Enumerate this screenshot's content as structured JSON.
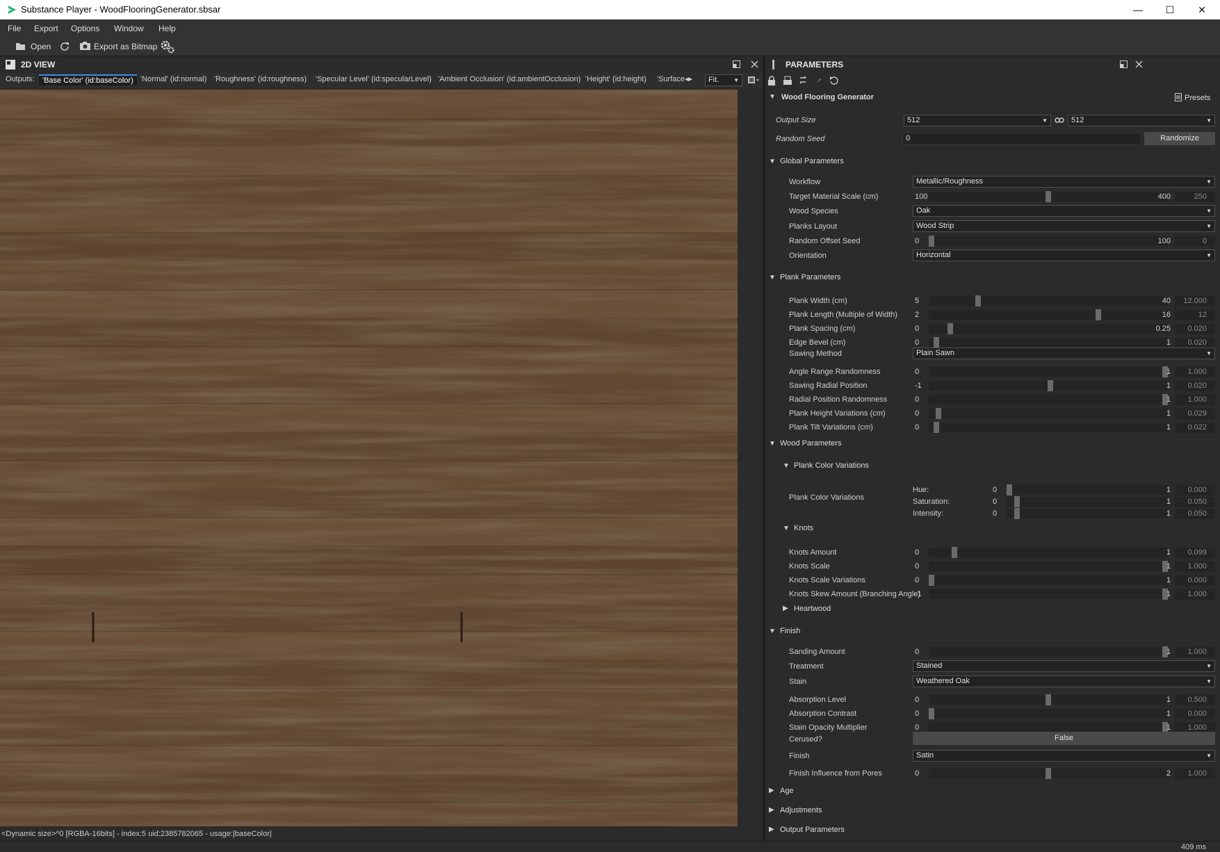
{
  "window": {
    "title": "Substance Player - WoodFlooringGenerator.sbsar",
    "minimize": "—",
    "maximize": "☐",
    "close": "✕"
  },
  "menu": [
    "File",
    "Export",
    "Options",
    "Window",
    "Help"
  ],
  "toolbar": {
    "open": "Open",
    "export_bitmap": "Export as Bitmap"
  },
  "view2d": {
    "title": "2D VIEW",
    "outputs_label": "Outputs:",
    "tabs": [
      "'Base Color' (id:baseColor)",
      "'Normal' (id:normal)",
      "'Roughness' (id:roughness)",
      "'Specular Level' (id:specularLevel)",
      "'Ambient Occlusion' (id:ambientOcclusion)",
      "'Height' (id:height)",
      "'Surface"
    ],
    "zoom": "Fit.",
    "status": "<Dynamic size>^0 [RGBA-16bits] - index:5 uid:2385782065 - usage:|baseColor|"
  },
  "params": {
    "title": "PARAMETERS",
    "graph": "Wood Flooring Generator",
    "presets": "Presets",
    "output_size": {
      "label": "Output Size",
      "w": "512",
      "h": "512"
    },
    "random_seed": {
      "label": "Random Seed",
      "value": "0",
      "button": "Randomize"
    },
    "global": {
      "title": "Global Parameters",
      "workflow": {
        "label": "Workflow",
        "value": "Metallic/Roughness"
      },
      "scale": {
        "label": "Target Material Scale (cm)",
        "min": "100",
        "max": "400",
        "value": "250",
        "fraction": 0.5
      },
      "species": {
        "label": "Wood Species",
        "value": "Oak"
      },
      "layout": {
        "label": "Planks Layout",
        "value": "Wood Strip"
      },
      "offset": {
        "label": "Random Offset Seed",
        "min": "0",
        "max": "100",
        "value": "0",
        "fraction": 0.0
      },
      "orientation": {
        "label": "Orientation",
        "value": "Horizontal"
      }
    },
    "plank": {
      "title": "Plank Parameters",
      "rows": [
        {
          "label": "Plank Width (cm)",
          "min": "5",
          "max": "40",
          "value": "12.000",
          "fraction": 0.2
        },
        {
          "label": "Plank Length (Multiple of Width)",
          "min": "2",
          "max": "16",
          "value": "12",
          "fraction": 0.714
        },
        {
          "label": "Plank Spacing (cm)",
          "min": "0",
          "max": "0.25",
          "value": "0.020",
          "fraction": 0.08
        },
        {
          "label": "Edge Bevel (cm)",
          "min": "0",
          "max": "1",
          "value": "0.020",
          "fraction": 0.02
        }
      ],
      "sawing": {
        "label": "Sawing Method",
        "value": "Plain Sawn"
      },
      "rows2": [
        {
          "label": "Angle Range Randomness",
          "min": "0",
          "max": "1",
          "value": "1.000",
          "fraction": 1.0
        },
        {
          "label": "Sawing Radial Position",
          "min": "-1",
          "max": "1",
          "value": "0.020",
          "fraction": 0.51
        },
        {
          "label": "Radial Position Randomness",
          "min": "0",
          "max": "1",
          "value": "1.000",
          "fraction": 1.0
        },
        {
          "label": "Plank Height Variations (cm)",
          "min": "0",
          "max": "1",
          "value": "0.029",
          "fraction": 0.029
        },
        {
          "label": "Plank Tilt Variations (cm)",
          "min": "0",
          "max": "1",
          "value": "0.022",
          "fraction": 0.022
        }
      ]
    },
    "wood": {
      "title": "Wood Parameters",
      "pcv_title": "Plank Color Variations",
      "pcv_label": "Plank Color Variations",
      "hsi": [
        {
          "label": "Hue:",
          "min": "0",
          "max": "1",
          "value": "0.000",
          "fraction": 0.0
        },
        {
          "label": "Saturation:",
          "min": "0",
          "max": "1",
          "value": "0.050",
          "fraction": 0.05
        },
        {
          "label": "Intensity:",
          "min": "0",
          "max": "1",
          "value": "0.050",
          "fraction": 0.05
        }
      ],
      "knots_title": "Knots",
      "knots": [
        {
          "label": "Knots Amount",
          "min": "0",
          "max": "1",
          "value": "0.099",
          "fraction": 0.099
        },
        {
          "label": "Knots Scale",
          "min": "0",
          "max": "1",
          "value": "1.000",
          "fraction": 1.0
        },
        {
          "label": "Knots Scale Variations",
          "min": "0",
          "max": "1",
          "value": "0.000",
          "fraction": 0.0
        },
        {
          "label": "Knots Skew Amount (Branching Angle)",
          "min": "-1",
          "max": "1",
          "value": "1.000",
          "fraction": 1.0
        }
      ],
      "heartwood": "Heartwood"
    },
    "finish": {
      "title": "Finish",
      "sanding": {
        "label": "Sanding Amount",
        "min": "0",
        "max": "1",
        "value": "1.000",
        "fraction": 1.0
      },
      "treatment": {
        "label": "Treatment",
        "value": "Stained"
      },
      "stain": {
        "label": "Stain",
        "value": "Weathered Oak"
      },
      "rows": [
        {
          "label": "Absorption Level",
          "min": "0",
          "max": "1",
          "value": "0.500",
          "fraction": 0.5
        },
        {
          "label": "Absorption Contrast",
          "min": "0",
          "max": "1",
          "value": "0.000",
          "fraction": 0.0
        },
        {
          "label": "Stain Opacity Multiplier",
          "min": "0",
          "max": "1",
          "value": "1.000",
          "fraction": 1.0
        }
      ],
      "cerused": {
        "label": "Cerused?",
        "value": "False"
      },
      "finish_sel": {
        "label": "Finish",
        "value": "Satin"
      },
      "pores": {
        "label": "Finish Influence from Pores",
        "min": "0",
        "max": "2",
        "value": "1.000",
        "fraction": 0.5
      }
    },
    "collapsed": [
      "Age",
      "Adjustments",
      "Output Parameters"
    ]
  },
  "timing": "409 ms"
}
